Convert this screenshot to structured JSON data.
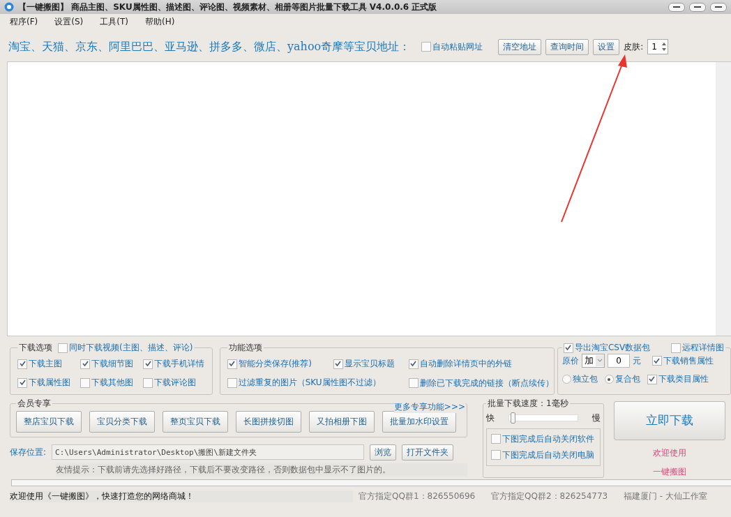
{
  "window": {
    "title": "【一键搬图】 商品主图、SKU属性图、描述图、评论图、视频素材、相册等图片批量下载工具 V4.0.0.6 正式版"
  },
  "menu": [
    {
      "label": "程序(F)"
    },
    {
      "label": "设置(S)"
    },
    {
      "label": "工具(T)"
    },
    {
      "label": "帮助(H)"
    }
  ],
  "url_bar": {
    "label": "淘宝、天猫、京东、阿里巴巴、亚马逊、拼多多、微店、yahoo奇摩等宝贝地址：",
    "auto_paste": {
      "label": "自动粘贴网址",
      "checked": false
    },
    "buttons": [
      "清空地址",
      "查询时间",
      "设置"
    ],
    "skin_label": "皮肤:",
    "skin_value": "1"
  },
  "download_options": {
    "title": "下载选项",
    "video": {
      "label": "同时下载视频(主图、描述、评论)",
      "checked": false
    },
    "items": [
      {
        "label": "下载主图",
        "checked": true
      },
      {
        "label": "下载细节图",
        "checked": true
      },
      {
        "label": "下载手机详情",
        "checked": true
      },
      {
        "label": "下载属性图",
        "checked": true
      },
      {
        "label": "下载其他图",
        "checked": false
      },
      {
        "label": "下载评论图",
        "checked": false
      }
    ]
  },
  "function_options": {
    "title": "功能选项",
    "items": [
      {
        "label": "智能分类保存(推荐)",
        "checked": true
      },
      {
        "label": "显示宝贝标题",
        "checked": true
      },
      {
        "label": "自动删除详情页中的外链",
        "checked": true
      },
      {
        "label": "过滤重复的图片（SKU属性图不过滤）",
        "checked": false
      },
      {
        "label": "删除已下载完成的链接（断点续传）",
        "checked": false
      }
    ]
  },
  "export": {
    "csv": {
      "label": "导出淘宝CSV数据包",
      "checked": true
    },
    "remote": {
      "label": "远程详情图",
      "checked": false
    },
    "price_label": "原价",
    "price_op": "加",
    "price_value": "0",
    "unit": "元",
    "sale_attr": {
      "label": "下载销售属性",
      "checked": true
    },
    "packages": [
      {
        "label": "独立包",
        "selected": false
      },
      {
        "label": "复合包",
        "selected": true
      }
    ],
    "category_attr": {
      "label": "下载类目属性",
      "checked": true
    }
  },
  "members": {
    "title": "会员专享",
    "more": "更多专享功能>>>",
    "buttons": [
      "整店宝贝下载",
      "宝贝分类下载",
      "整页宝贝下载",
      "长图拼接切图",
      "又拍相册下图",
      "批量加水印设置"
    ]
  },
  "speed": {
    "title": "批量下载速度：1毫秒",
    "fast": "快",
    "slow": "慢",
    "level": 0.02,
    "options": [
      {
        "label": "下图完成后自动关闭软件",
        "checked": false
      },
      {
        "label": "下图完成后自动关闭电脑",
        "checked": false
      }
    ]
  },
  "download_button": "立即下载",
  "welcome": [
    "欢迎使用",
    "一键搬图"
  ],
  "save": {
    "label": "保存位置:",
    "path": "C:\\Users\\Administrator\\Desktop\\搬图\\新建文件夹",
    "buttons": [
      "浏览",
      "打开文件夹"
    ],
    "tip": "友情提示：下载前请先选择好路径，下载后不要改变路径，否则数据包中显示不了图片的。"
  },
  "progress": {
    "level": 0
  },
  "status_bar": [
    "欢迎使用《一键搬图》，快速打造您的网络商城！",
    "官方指定QQ群1：826550696",
    "官方指定QQ群2：826254773",
    "福建厦门 - 大仙工作室"
  ]
}
